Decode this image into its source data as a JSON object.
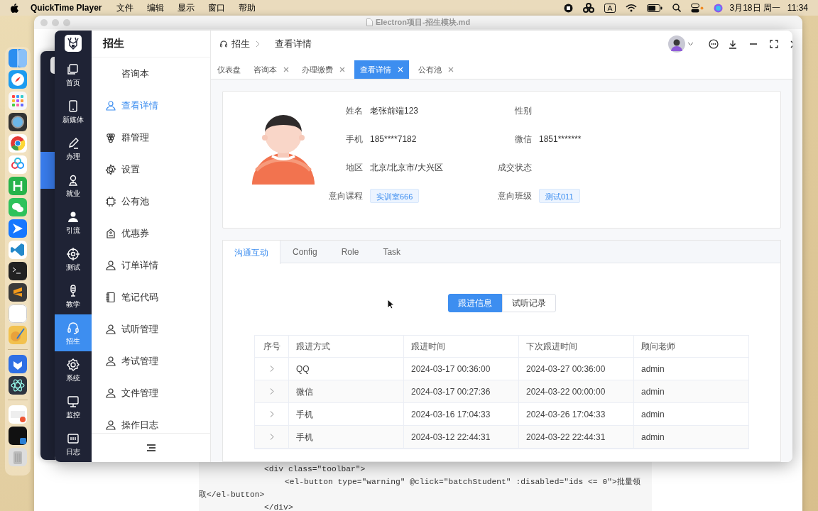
{
  "menubar": {
    "app": "QuickTime Player",
    "menus": [
      "文件",
      "编辑",
      "显示",
      "窗口",
      "帮助"
    ],
    "date": "3月18日 周一",
    "time": "11:34"
  },
  "editor_window": {
    "title": "Electron项目-招生模块.md",
    "code_lines": [
      {
        "text": "<div class=\"toolbar\">",
        "kind": "outer"
      },
      {
        "text": "<el-button type=\"warning\" @click=\"batchStudent\" :disabled=\"ids <= 0\">批量领",
        "kind": "inner"
      },
      {
        "text": "取</el-button>",
        "kind": "wrapped"
      },
      {
        "text": "</div>",
        "kind": "outer"
      }
    ]
  },
  "app": {
    "nav_items": [
      {
        "label": "首页",
        "selected": false
      },
      {
        "label": "新媒体",
        "selected": false
      },
      {
        "label": "办理",
        "selected": false
      },
      {
        "label": "就业",
        "selected": false
      },
      {
        "label": "引流",
        "selected": false
      },
      {
        "label": "测试",
        "selected": false
      },
      {
        "label": "教学",
        "selected": false
      },
      {
        "label": "招生",
        "selected": true
      },
      {
        "label": "系统",
        "selected": false
      },
      {
        "label": "监控",
        "selected": false
      },
      {
        "label": "日志",
        "selected": false
      }
    ],
    "section_title": "招生",
    "submenu": [
      {
        "label": "咨询本",
        "selected": false
      },
      {
        "label": "查看详情",
        "selected": true
      },
      {
        "label": "群管理",
        "selected": false
      },
      {
        "label": "设置",
        "selected": false
      },
      {
        "label": "公有池",
        "selected": false
      },
      {
        "label": "优惠券",
        "selected": false
      },
      {
        "label": "订单详情",
        "selected": false
      },
      {
        "label": "笔记代码",
        "selected": false
      },
      {
        "label": "试听管理",
        "selected": false
      },
      {
        "label": "考试管理",
        "selected": false
      },
      {
        "label": "文件管理",
        "selected": false
      },
      {
        "label": "操作日志",
        "selected": false
      }
    ],
    "breadcrumb": [
      "招生",
      "查看详情"
    ],
    "tabs": [
      {
        "label": "仪表盘",
        "selected": false,
        "closable": false
      },
      {
        "label": "咨询本",
        "selected": false,
        "closable": true
      },
      {
        "label": "办理缴费",
        "selected": false,
        "closable": true
      },
      {
        "label": "查看详情",
        "selected": true,
        "closable": true
      },
      {
        "label": "公有池",
        "selected": false,
        "closable": true
      }
    ],
    "profile": [
      [
        {
          "label": "姓名",
          "value": "老张前端123",
          "kind": "text"
        },
        {
          "label": "性别"
        }
      ],
      [
        {
          "label": "手机",
          "value": "185****7182",
          "kind": "text"
        },
        {
          "label": "微信",
          "value": "1851*******",
          "kind": "text"
        }
      ],
      [
        {
          "label": "地区",
          "value": "北京/北京市/大兴区",
          "kind": "text"
        },
        {
          "label": "成交状态"
        }
      ],
      [
        {
          "label": "意向课程",
          "value": "实训室666",
          "kind": "tag"
        },
        {
          "label": "意向班级",
          "value": "测试011",
          "kind": "tag"
        }
      ]
    ],
    "detail_tabs": [
      {
        "label": "沟通互动",
        "selected": true
      },
      {
        "label": "Config",
        "selected": false
      },
      {
        "label": "Role",
        "selected": false
      },
      {
        "label": "Task",
        "selected": false
      }
    ],
    "segments": [
      {
        "label": "跟进信息",
        "selected": true
      },
      {
        "label": "试听记录",
        "selected": false
      }
    ],
    "table": {
      "columns": [
        "序号",
        "跟进方式",
        "跟进时间",
        "下次跟进时间",
        "顾问老师"
      ],
      "rows": [
        {
          "expanded": false,
          "cells": [
            "",
            "QQ",
            "2024-03-17 00:36:00",
            "2024-03-27 00:36:00",
            "admin"
          ]
        },
        {
          "expanded": false,
          "cells": [
            "",
            "微信",
            "2024-03-17 00:27:36",
            "2024-03-22 00:00:00",
            "admin"
          ]
        },
        {
          "expanded": false,
          "cells": [
            "",
            "手机",
            "2024-03-16 17:04:33",
            "2024-03-26 17:04:33",
            "admin"
          ]
        },
        {
          "expanded": false,
          "cells": [
            "",
            "手机",
            "2024-03-12 22:44:31",
            "2024-03-22 22:44:31",
            "admin"
          ]
        }
      ]
    }
  }
}
